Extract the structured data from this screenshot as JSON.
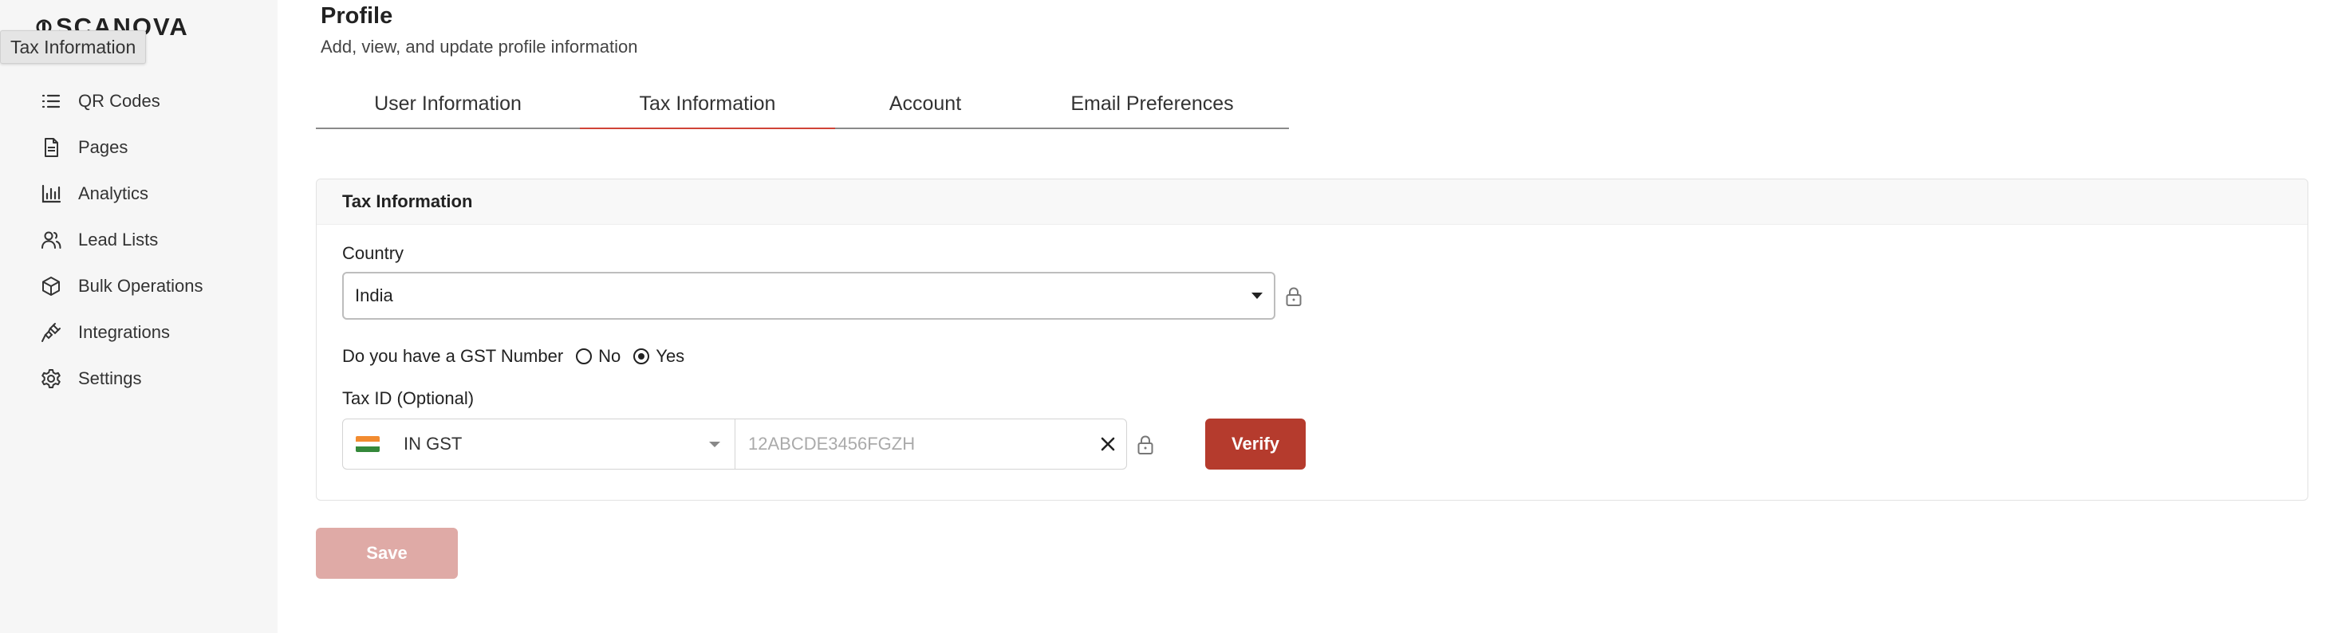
{
  "app": {
    "brand": "SCANOVA",
    "tooltip": "Tax Information"
  },
  "sidebar": {
    "items": [
      {
        "label": "QR Codes",
        "icon": "list-icon"
      },
      {
        "label": "Pages",
        "icon": "page-icon"
      },
      {
        "label": "Analytics",
        "icon": "bar-chart-icon"
      },
      {
        "label": "Lead Lists",
        "icon": "users-icon"
      },
      {
        "label": "Bulk Operations",
        "icon": "box-icon"
      },
      {
        "label": "Integrations",
        "icon": "plug-icon"
      },
      {
        "label": "Settings",
        "icon": "gear-icon"
      }
    ]
  },
  "header": {
    "title": "Profile",
    "subtitle": "Add, view, and update profile information"
  },
  "tabs": [
    {
      "label": "User Information",
      "active": false
    },
    {
      "label": "Tax Information",
      "active": true
    },
    {
      "label": "Account",
      "active": false
    },
    {
      "label": "Email Preferences",
      "active": false
    }
  ],
  "card": {
    "title": "Tax Information",
    "country_label": "Country",
    "country_value": "India",
    "gst_question": "Do you have a GST Number",
    "gst_no_label": "No",
    "gst_yes_label": "Yes",
    "gst_selected": "Yes",
    "taxid_label": "Tax ID (Optional)",
    "taxid_type": "IN GST",
    "taxid_placeholder": "12ABCDE3456FGZH",
    "verify_label": "Verify"
  },
  "footer": {
    "save_label": "Save"
  },
  "colors": {
    "accent": "#d04437",
    "verify_button": "#b53b2d",
    "save_button_disabled": "#dfaaa6",
    "sidebar_bg": "#f6f6f6"
  }
}
